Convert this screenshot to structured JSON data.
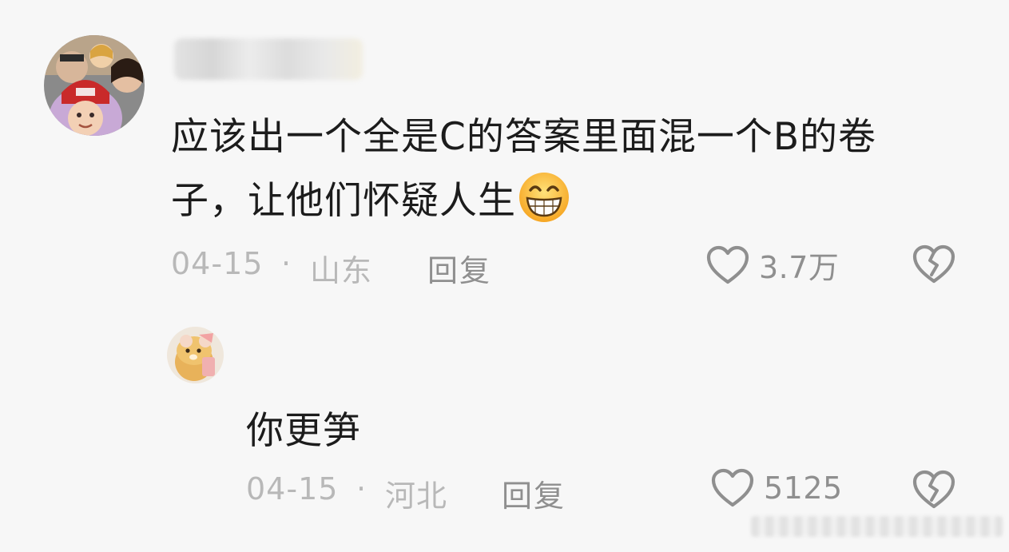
{
  "comments": [
    {
      "text_line1": "应该出一个全是C的答案里面混一个B的卷",
      "text_line2": "子，让他们怀疑人生",
      "emoji": "grinning-face",
      "date": "04-15",
      "separator": "·",
      "location": "山东",
      "reply_label": "回复",
      "like_count": "3.7万"
    },
    {
      "text": "你更笋",
      "date": "04-15",
      "separator": "·",
      "location": "河北",
      "reply_label": "回复",
      "like_count": "5125"
    }
  ],
  "icons": {
    "like": "heart-outline-icon",
    "dislike": "broken-heart-icon"
  },
  "colors": {
    "background": "#f7f7f7",
    "text": "#1c1c1c",
    "meta": "#b8b8b8",
    "action": "#8f8f8f"
  }
}
